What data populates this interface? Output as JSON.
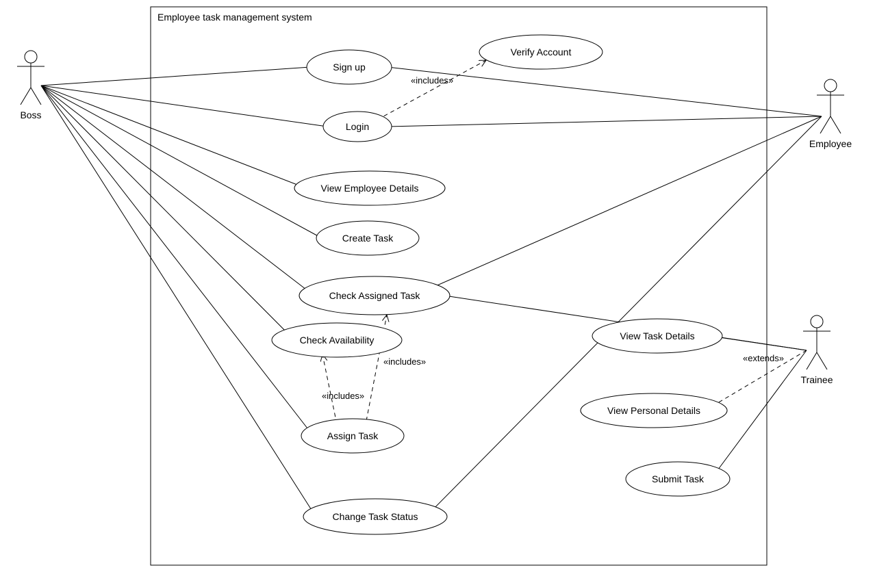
{
  "system": {
    "title": "Employee task management system"
  },
  "actors": {
    "boss": {
      "label": "Boss"
    },
    "employee": {
      "label": "Employee"
    },
    "trainee": {
      "label": "Trainee"
    }
  },
  "usecases": {
    "signup": {
      "label": "Sign up"
    },
    "login": {
      "label": "Login"
    },
    "verify_account": {
      "label": "Verify Account"
    },
    "view_employee_details": {
      "label": "View Employee Details"
    },
    "create_task": {
      "label": "Create Task"
    },
    "check_assigned_task": {
      "label": "Check Assigned Task"
    },
    "check_availability": {
      "label": "Check Availability"
    },
    "assign_task": {
      "label": "Assign Task"
    },
    "change_task_status": {
      "label": "Change Task Status"
    },
    "view_task_details": {
      "label": "View Task Details"
    },
    "view_personal_details": {
      "label": "View Personal Details"
    },
    "submit_task": {
      "label": "Submit Task"
    }
  },
  "relationships": {
    "includes": "«includes»",
    "extends": "«extends»"
  },
  "chart_data": {
    "type": "uml-use-case",
    "system_boundary": "Employee task management system",
    "actors": [
      "Boss",
      "Employee",
      "Trainee"
    ],
    "use_cases": [
      "Sign up",
      "Login",
      "Verify Account",
      "View Employee Details",
      "Create Task",
      "Check Assigned Task",
      "Check Availability",
      "Assign Task",
      "Change Task Status",
      "View Task Details",
      "View Personal Details",
      "Submit Task"
    ],
    "associations": [
      {
        "actor": "Boss",
        "usecase": "Sign up"
      },
      {
        "actor": "Boss",
        "usecase": "Login"
      },
      {
        "actor": "Boss",
        "usecase": "View Employee Details"
      },
      {
        "actor": "Boss",
        "usecase": "Create Task"
      },
      {
        "actor": "Boss",
        "usecase": "Check Assigned Task"
      },
      {
        "actor": "Boss",
        "usecase": "Check Availability"
      },
      {
        "actor": "Boss",
        "usecase": "Assign Task"
      },
      {
        "actor": "Boss",
        "usecase": "Change Task Status"
      },
      {
        "actor": "Employee",
        "usecase": "Sign up"
      },
      {
        "actor": "Employee",
        "usecase": "Login"
      },
      {
        "actor": "Employee",
        "usecase": "Check Assigned Task"
      },
      {
        "actor": "Employee",
        "usecase": "Change Task Status"
      },
      {
        "actor": "Trainee",
        "usecase": "Check Assigned Task"
      },
      {
        "actor": "Trainee",
        "usecase": "View Task Details"
      },
      {
        "actor": "Trainee",
        "usecase": "View Personal Details"
      },
      {
        "actor": "Trainee",
        "usecase": "Submit Task"
      }
    ],
    "dependencies": [
      {
        "from": "Login",
        "to": "Verify Account",
        "type": "includes"
      },
      {
        "from": "Assign Task",
        "to": "Check Availability",
        "type": "includes"
      },
      {
        "from": "Assign Task",
        "to": "Check Assigned Task",
        "type": "includes"
      },
      {
        "from": "Trainee",
        "to": "View Personal Details",
        "type": "extends"
      }
    ]
  }
}
